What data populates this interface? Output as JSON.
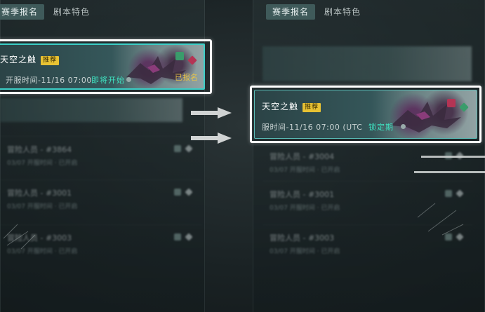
{
  "tabs": {
    "registration": "赛季报名",
    "features": "剧本特色"
  },
  "left_card": {
    "title": "天空之触",
    "badge": "推荐",
    "time": "开服时间-11/16 07:00",
    "status": "即将开始",
    "signed": "已报名"
  },
  "right_card": {
    "title": "天空之触",
    "badge": "推荐",
    "time": "服时间-11/16 07:00 (UTC",
    "status": "锁定期"
  },
  "rows_left": [
    {
      "title": "冒险人员 - #3864",
      "sub": "03/07 开服时间 · 已开启"
    },
    {
      "title": "冒险人员 - #3001",
      "sub": "03/07 开服时间 · 已开启"
    },
    {
      "title": "冒险人员 - #3003",
      "sub": "03/07 开服时间 · 已开启"
    }
  ],
  "rows_right": [
    {
      "title": "冒险人员 - #3004",
      "sub": "03/07 开服时间 · 已开启"
    },
    {
      "title": "冒险人员 - #3001",
      "sub": "03/07 开服时间 · 已开启"
    },
    {
      "title": "冒险人员 - #3003",
      "sub": "03/07 开服时间 · 已开启"
    }
  ],
  "colors": {
    "accent": "#3ccfc7",
    "status_green": "#3fe3c1",
    "badge_yellow": "#e8c233",
    "signed_gold": "#e5c14a",
    "highlight_outline": "#ffffff"
  },
  "icons": [
    "dragon-art",
    "server-flag-icon",
    "arrow-right-icon"
  ]
}
